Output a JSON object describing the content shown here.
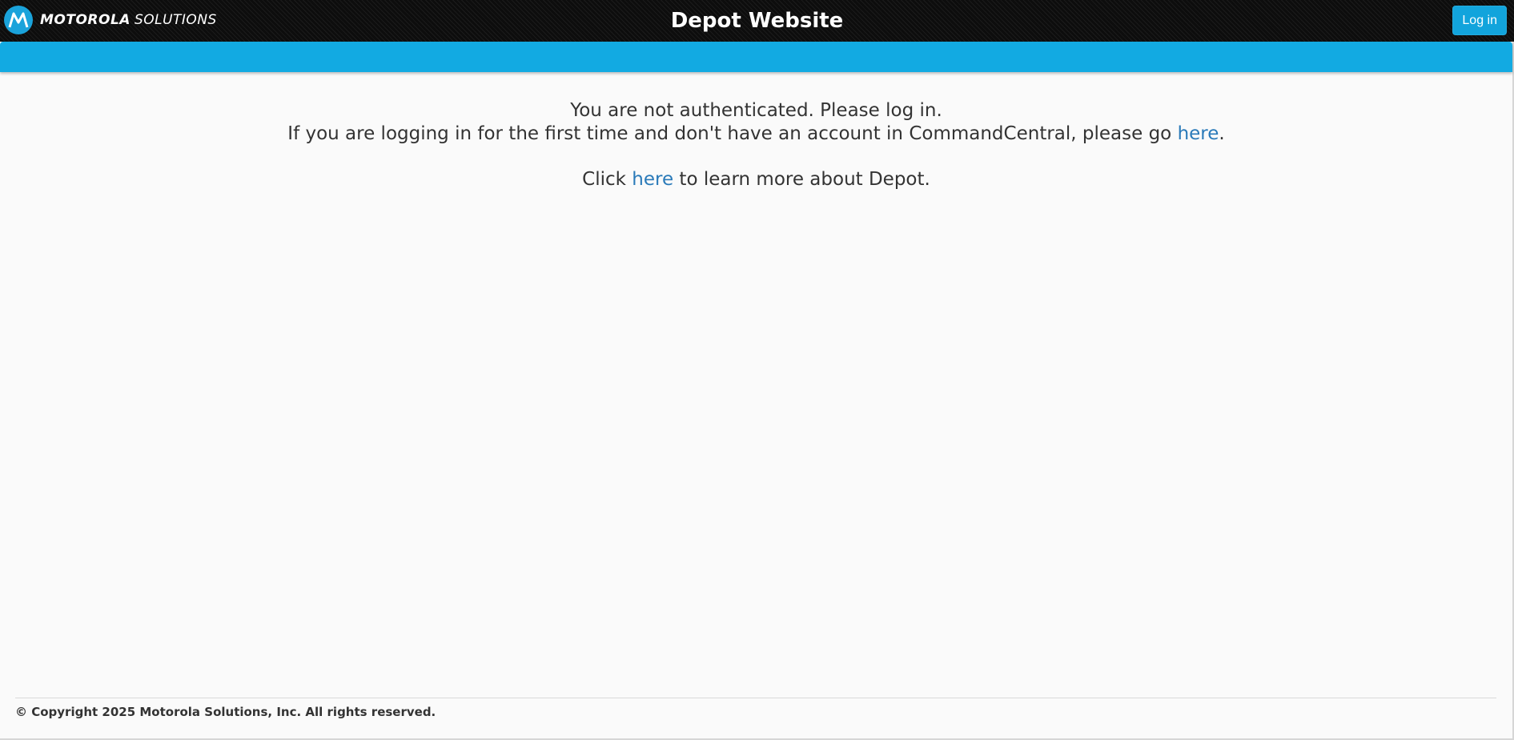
{
  "header": {
    "brand_bold": "MOTOROLA",
    "brand_light": "SOLUTIONS",
    "title": "Depot Website",
    "login_label": "Log in",
    "logo_icon": "motorola-batwing-icon",
    "brand_color": "#1aa3db"
  },
  "nav": {
    "color": "#12aae2"
  },
  "main": {
    "line1": "You are not authenticated. Please log in.",
    "line2_prefix": "If you are logging in for the first time and don't have an account in CommandCentral, please go ",
    "line2_link": "here",
    "line2_suffix": ".",
    "line3_prefix": "Click ",
    "line3_link": "here",
    "line3_suffix": " to learn more about Depot.",
    "link_color": "#2a7ab9"
  },
  "footer": {
    "copyright": "© Copyright 2025 Motorola Solutions, Inc. All rights reserved."
  }
}
